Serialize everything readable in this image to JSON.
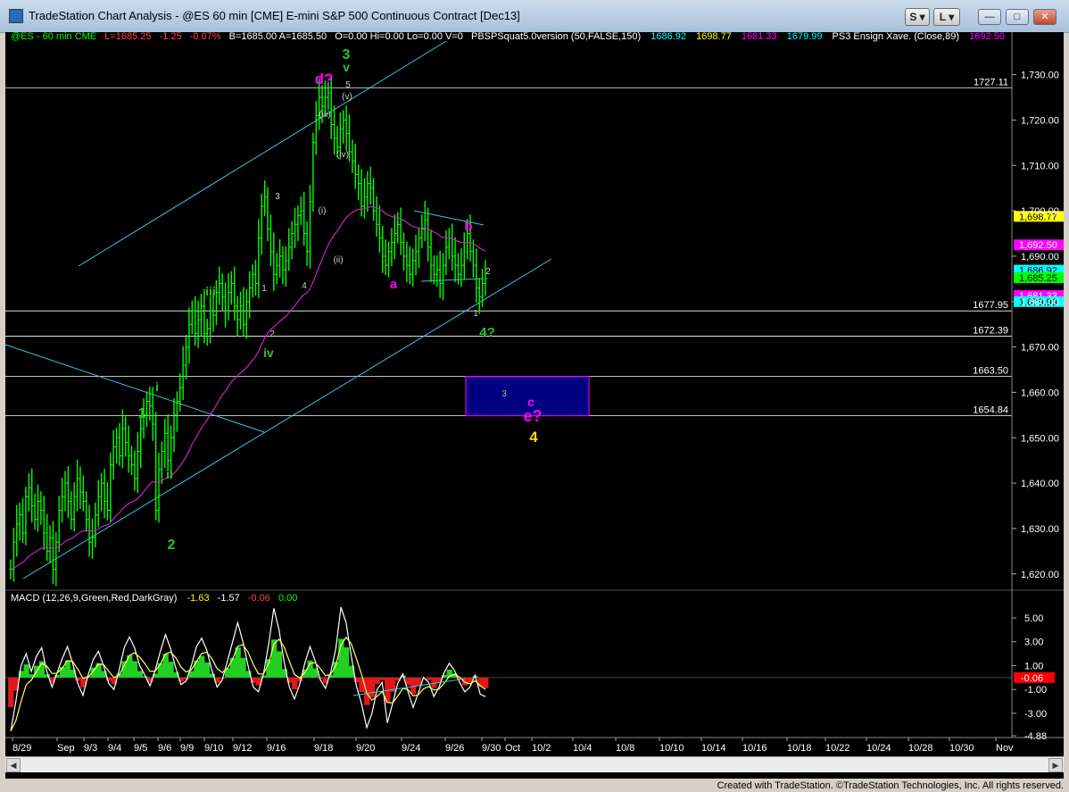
{
  "window": {
    "title": "TradeStation Chart Analysis - @ES 60 min [CME] E-mini S&P 500 Continuous Contract [Dec13]",
    "btn_s": "S",
    "btn_l": "L"
  },
  "status_line": {
    "symbol": "@ES - 60 min  CME",
    "last": "L=1685.25",
    "chg": "-1.25",
    "pct": "-0.07%",
    "b_a": "B=1685.00   A=1685.50",
    "ohlv": "O=0.00   Hi=0.00   Lo=0.00   V=0",
    "study": "PBSPSquat5.0version (50,FALSE,150)",
    "study_v1": "1686.92",
    "study_v2": "1698.77",
    "study_v3": "1681.33",
    "study_v4": "1679.99",
    "ema": "PS3 Ensign Xave. (Close,89)",
    "ema_v": "1692.50"
  },
  "macd_status": {
    "label": "MACD (12,26,9,Green,Red,DarkGray)",
    "v1": "-1.63",
    "v2": "-1.57",
    "v3": "-0.06",
    "v4": "0.00"
  },
  "footer": "Created with TradeStation. ©TradeStation Technologies, Inc. All rights reserved.",
  "chart_data": [
    {
      "type": "line",
      "subtype": "ohlc-bars",
      "title": "",
      "price_axis_ticks": [
        1620,
        1630,
        1640,
        1650,
        1660,
        1670,
        1680,
        1690,
        1700,
        1710,
        1720,
        1730
      ],
      "price_axis_labels": [
        "1,620.00",
        "1,630.00",
        "1,640.00",
        "1,650.00",
        "1,660.00",
        "1,670.00",
        "1,680.00",
        "1,690.00",
        "1,700.00",
        "1,710.00",
        "1,720.00",
        "1,730.00"
      ],
      "ylim": [
        1617,
        1737
      ],
      "date_labels": [
        "8/29",
        "Sep",
        "9/3",
        "9/4",
        "9/5",
        "9/6",
        "9/9",
        "9/10",
        "9/12",
        "9/16",
        "9/18",
        "9/20",
        "9/24",
        "9/26",
        "9/30",
        "Oct",
        "10/2",
        "10/4",
        "10/8",
        "10/10",
        "10/14",
        "10/16",
        "10/18",
        "10/22",
        "10/24",
        "10/28",
        "10/30",
        "Nov"
      ],
      "price_series": {
        "name": "@ES",
        "color": "#00ff00",
        "bars": [
          1621,
          1627,
          1631,
          1633,
          1629,
          1637,
          1639,
          1635,
          1632,
          1636,
          1634,
          1629,
          1625,
          1628,
          1621,
          1627,
          1634,
          1637,
          1640,
          1636,
          1632,
          1637,
          1641,
          1638,
          1636,
          1632,
          1627,
          1628,
          1633,
          1637,
          1640,
          1636,
          1634,
          1644,
          1648,
          1650,
          1646,
          1652,
          1649,
          1646,
          1644,
          1641,
          1647,
          1652,
          1655,
          1658,
          1657,
          1653,
          1634,
          1643,
          1647,
          1651,
          1645,
          1650,
          1655,
          1658,
          1661,
          1666,
          1670,
          1675,
          1678,
          1673,
          1676,
          1679,
          1673,
          1674,
          1678,
          1677,
          1682,
          1684,
          1681,
          1678,
          1682,
          1684,
          1679,
          1676,
          1679,
          1675,
          1680,
          1683,
          1686,
          1684,
          1694,
          1701,
          1703,
          1696,
          1691,
          1686,
          1688,
          1690,
          1687,
          1689,
          1692,
          1695,
          1697,
          1699,
          1700,
          1695,
          1691,
          1702,
          1715,
          1721,
          1725,
          1723,
          1725,
          1726,
          1719,
          1716,
          1714,
          1718,
          1720,
          1717,
          1713,
          1711,
          1708,
          1706,
          1701,
          1703,
          1706,
          1705,
          1700,
          1697,
          1694,
          1690,
          1688,
          1691,
          1693,
          1695,
          1697,
          1693,
          1690,
          1688,
          1686,
          1689,
          1691,
          1694,
          1696,
          1698,
          1692,
          1688,
          1686,
          1687,
          1684,
          1688,
          1692,
          1694,
          1690,
          1688,
          1686,
          1688,
          1693,
          1695,
          1691,
          1688,
          1683,
          1681,
          1684,
          1685
        ]
      },
      "moving_average": {
        "name": "PS3 Ensign Xave. (Close,89)",
        "color": "#cc22cc",
        "last": 1692.5
      },
      "horizontal_levels": [
        1727.11,
        1677.95,
        1672.39,
        1663.5,
        1654.84
      ],
      "level_labels": [
        "1727.11",
        "1677.95",
        "1672.39",
        "1663.50",
        "1654.84"
      ],
      "price_markers": [
        {
          "value": "1,698.77",
          "color": "#ffff00",
          "text_color": "#000"
        },
        {
          "value": "1,692.50",
          "color": "#ff00ff",
          "text_color": "#fff"
        },
        {
          "value": "1,686.92",
          "color": "#00ffff",
          "text_color": "#000"
        },
        {
          "value": "1,685.25",
          "color": "#00ff00",
          "text_color": "#000"
        },
        {
          "value": "1,681.33",
          "color": "#ff00ff",
          "text_color": "#fff"
        },
        {
          "value": "1,679.99",
          "color": "#00ffff",
          "text_color": "#000"
        }
      ],
      "target_box": {
        "from": 1654.84,
        "to": 1663.5,
        "color": "#000080"
      },
      "wave_labels": [
        {
          "text": "3",
          "color": "#22c822"
        },
        {
          "text": "v",
          "color": "#22c822"
        },
        {
          "text": "d?",
          "color": "#ff00ff"
        },
        {
          "text": "5",
          "color": "#cccccc"
        },
        {
          "text": "(v)",
          "color": "#cccccc"
        },
        {
          "text": "(iii)",
          "color": "#cccccc"
        },
        {
          "text": "(iv)",
          "color": "#cccccc"
        },
        {
          "text": "(i)",
          "color": "#cccccc"
        },
        {
          "text": "(ii)",
          "color": "#cccccc"
        },
        {
          "text": "3",
          "color": "#cccccc"
        },
        {
          "text": "4",
          "color": "#cccccc"
        },
        {
          "text": "iii",
          "color": "#22c822"
        },
        {
          "text": "1",
          "color": "#cccccc"
        },
        {
          "text": "2",
          "color": "#cccccc"
        },
        {
          "text": "iv",
          "color": "#22c822"
        },
        {
          "text": "i",
          "color": "#22c822"
        },
        {
          "text": "1",
          "color": "#22c822"
        },
        {
          "text": "ii",
          "color": "#22c822"
        },
        {
          "text": "2",
          "color": "#22c822"
        },
        {
          "text": "a",
          "color": "#ff00ff"
        },
        {
          "text": "b",
          "color": "#ff00ff"
        },
        {
          "text": "2",
          "color": "#cccccc"
        },
        {
          "text": "1",
          "color": "#cccccc"
        },
        {
          "text": "4?",
          "color": "#22c822"
        },
        {
          "text": "3",
          "color": "#aaaaaa"
        },
        {
          "text": "c",
          "color": "#ff00ff"
        },
        {
          "text": "e?",
          "color": "#ff00ff"
        },
        {
          "text": "4",
          "color": "#ffd700"
        }
      ]
    },
    {
      "type": "area",
      "title": "MACD (12,26,9,Green,Red,DarkGray)",
      "ylim": [
        -4.88,
        6.2
      ],
      "axis_labels": [
        "5.00",
        "3.00",
        "1.00",
        "-1.00",
        "-3.00",
        "-4.88"
      ],
      "axis_ticks": [
        5,
        3,
        1,
        -1,
        -3,
        -4.88
      ],
      "last_label": "-0.06",
      "macd": [
        -4.5,
        -2,
        1,
        2,
        0.5,
        1.8,
        2.5,
        0.5,
        -0.8,
        0.4,
        1.6,
        2.6,
        1.2,
        -0.5,
        -1.5,
        0.2,
        1.5,
        2.2,
        1.0,
        -0.5,
        -1.0,
        0.6,
        2.5,
        3.4,
        2.5,
        1.0,
        0.2,
        -0.7,
        0.6,
        2.2,
        3.6,
        2.4,
        0.8,
        -0.6,
        -0.3,
        1.0,
        2.6,
        3.3,
        2.3,
        0.6,
        -0.8,
        -0.2,
        1.4,
        3.0,
        4.6,
        3.0,
        1.0,
        -0.8,
        -1.2,
        0.3,
        2.8,
        5.8,
        4.0,
        1.3,
        -0.8,
        -1.8,
        -0.6,
        1.2,
        2.6,
        1.4,
        -0.2,
        -0.9,
        0.4,
        2.4,
        5.9,
        4.6,
        1.8,
        -0.7,
        -2.2,
        -4.2,
        -3.0,
        -1.0,
        -0.4,
        -3.8,
        -2.2,
        -0.5,
        0.3,
        -1.2,
        -2.5,
        -1.3,
        0.0,
        -0.4,
        -1.6,
        -0.8,
        0.4,
        1.2,
        0.6,
        -0.4,
        -1.2,
        -0.8,
        0.2,
        -1.4,
        -1.6
      ]
    }
  ]
}
